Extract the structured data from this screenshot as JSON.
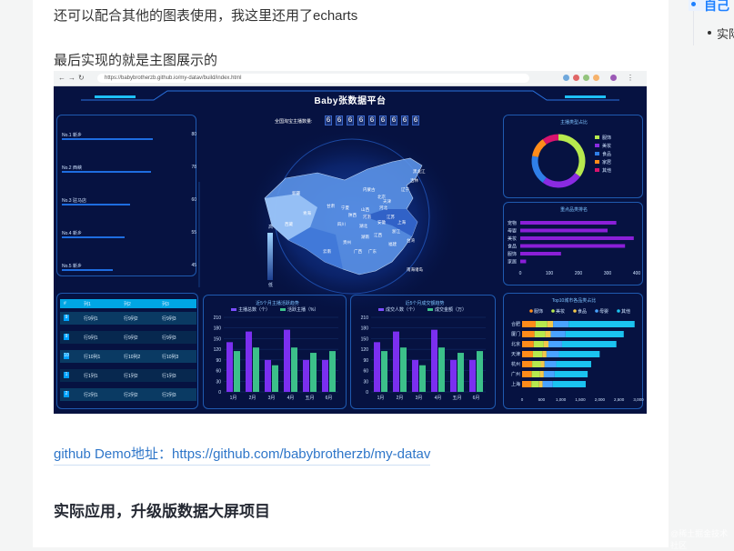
{
  "article": {
    "paragraph_1": "还可以配合其他的图表使用，我这里还用了echarts",
    "paragraph_2": "最后实现的就是主图展示的",
    "link": "github Demo地址：https://github.com/babybrotherzb/my-datav",
    "heading": "实际应用，升级版数据大屏项目"
  },
  "toc": {
    "item_1": "自己",
    "item_2": "实际"
  },
  "watermark": "@稀土掘金技术社区",
  "screenshot": {
    "browser": {
      "url": "https://babybrotherzb.github.io/my-datav/build/index.html"
    },
    "dashboard": {
      "title": "Baby张数据平台",
      "map_caption": "全国淘宝主播数量:",
      "digits": [
        "6",
        "6",
        "6",
        "6",
        "6",
        "6",
        "6",
        "6",
        "6"
      ],
      "ranking": [
        {
          "label": "No.1 新乡",
          "value": "80",
          "fill": 0.8
        },
        {
          "label": "No.2 西峡",
          "value": "78",
          "fill": 0.78
        },
        {
          "label": "No.3 驻马店",
          "value": "60",
          "fill": 0.6
        },
        {
          "label": "No.4 新乡",
          "value": "55",
          "fill": 0.55
        },
        {
          "label": "No.5 新乡",
          "value": "45",
          "fill": 0.45
        }
      ],
      "table": {
        "headers": [
          "#",
          "列1",
          "列2",
          "列3"
        ],
        "rows": [
          [
            "9",
            "行9列1",
            "行9列2",
            "行9列3"
          ],
          [
            "9",
            "行9列1",
            "行9列2",
            "行9列3"
          ],
          [
            "10",
            "行10列1",
            "行10列2",
            "行10列3"
          ],
          [
            "1",
            "行1列1",
            "行1列2",
            "行1列3"
          ],
          [
            "2",
            "行2列1",
            "行2列2",
            "行2列3"
          ]
        ]
      },
      "provinces": [
        "新疆",
        "西藏",
        "青海",
        "四川",
        "甘肃",
        "内蒙古",
        "黑龙江",
        "吉林",
        "辽宁",
        "北京",
        "天津",
        "河北",
        "山西",
        "陕西",
        "宁夏",
        "河南",
        "湖北",
        "江苏",
        "上海",
        "浙江",
        "安徽",
        "江西",
        "湖南",
        "贵州",
        "云南",
        "广西",
        "广东",
        "福建",
        "台湾",
        "南海诸岛"
      ],
      "map_legend": {
        "high": "高",
        "low": "低"
      },
      "donut": {
        "title": "主播类型占比",
        "slices": [
          {
            "name": "服饰",
            "value": 35,
            "color": "#b7e94e"
          },
          {
            "name": "美妆",
            "value": 25,
            "color": "#8a2be2"
          },
          {
            "name": "食品",
            "value": 18,
            "color": "#2f7fe8"
          },
          {
            "name": "家居",
            "value": 12,
            "color": "#ff8c1a"
          },
          {
            "name": "其他",
            "value": 10,
            "color": "#d8136e"
          }
        ]
      },
      "hbar": {
        "title": "重点品类排名",
        "categories": [
          "宠物",
          "母婴",
          "美妆",
          "食品",
          "服饰",
          "家居"
        ],
        "values": [
          330,
          300,
          390,
          360,
          140,
          20
        ],
        "ticks": [
          "0",
          "100",
          "200",
          "300",
          "400"
        ],
        "xmax": 400
      },
      "bar_left": {
        "title": "近5个月主播活跃趋势",
        "legend": [
          "主播总数（个）",
          "活跃主播（%）"
        ],
        "categories": [
          "1月",
          "2月",
          "3月",
          "4月",
          "五月",
          "6月"
        ],
        "values_a": [
          140,
          170,
          90,
          175,
          90,
          90
        ],
        "values_b": [
          115,
          125,
          75,
          125,
          110,
          115
        ],
        "yticks": [
          "0",
          "30",
          "60",
          "90",
          "120",
          "150",
          "180",
          "210"
        ],
        "ymax": 210
      },
      "bar_right": {
        "title": "近5个月成交额趋势",
        "legend": [
          "成交人数（个）",
          "成交金额（万）"
        ],
        "categories": [
          "1月",
          "2月",
          "3月",
          "4月",
          "五月",
          "6月"
        ],
        "values_a": [
          140,
          170,
          90,
          175,
          90,
          90
        ],
        "values_b": [
          115,
          125,
          75,
          125,
          110,
          115
        ],
        "yticks": [
          "0",
          "30",
          "60",
          "90",
          "120",
          "150",
          "180",
          "210"
        ],
        "ymax": 210
      },
      "stacked": {
        "title": "Top10城市各品类占比",
        "legend": [
          "服饰",
          "美妆",
          "食品",
          "母婴",
          "其他"
        ],
        "colors": [
          "#ff8c1a",
          "#b7e94e",
          "#f2c84b",
          "#4aa3ff",
          "#1bc3f0"
        ],
        "categories": [
          "合肥",
          "厦门",
          "北京",
          "天津",
          "杭州",
          "广州",
          "上海"
        ],
        "series": [
          [
            350,
            320,
            300,
            280,
            260,
            250,
            240
          ],
          [
            300,
            280,
            260,
            240,
            220,
            210,
            200
          ],
          [
            150,
            140,
            120,
            110,
            100,
            100,
            90
          ],
          [
            400,
            380,
            350,
            320,
            300,
            280,
            260
          ],
          [
            1700,
            1500,
            1400,
            1050,
            900,
            850,
            850
          ]
        ],
        "ticks": [
          "0",
          "500",
          "1,000",
          "1,500",
          "2,000",
          "2,500",
          "3,000"
        ],
        "xmax": 3000
      }
    }
  }
}
